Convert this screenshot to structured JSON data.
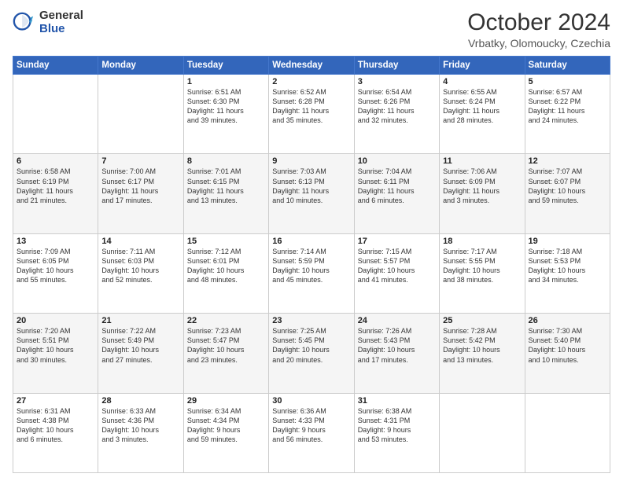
{
  "header": {
    "logo": {
      "general": "General",
      "blue": "Blue"
    },
    "title": "October 2024",
    "location": "Vrbatky, Olomoucky, Czechia"
  },
  "calendar": {
    "days_of_week": [
      "Sunday",
      "Monday",
      "Tuesday",
      "Wednesday",
      "Thursday",
      "Friday",
      "Saturday"
    ],
    "weeks": [
      [
        {
          "day": "",
          "detail": ""
        },
        {
          "day": "",
          "detail": ""
        },
        {
          "day": "1",
          "detail": "Sunrise: 6:51 AM\nSunset: 6:30 PM\nDaylight: 11 hours\nand 39 minutes."
        },
        {
          "day": "2",
          "detail": "Sunrise: 6:52 AM\nSunset: 6:28 PM\nDaylight: 11 hours\nand 35 minutes."
        },
        {
          "day": "3",
          "detail": "Sunrise: 6:54 AM\nSunset: 6:26 PM\nDaylight: 11 hours\nand 32 minutes."
        },
        {
          "day": "4",
          "detail": "Sunrise: 6:55 AM\nSunset: 6:24 PM\nDaylight: 11 hours\nand 28 minutes."
        },
        {
          "day": "5",
          "detail": "Sunrise: 6:57 AM\nSunset: 6:22 PM\nDaylight: 11 hours\nand 24 minutes."
        }
      ],
      [
        {
          "day": "6",
          "detail": "Sunrise: 6:58 AM\nSunset: 6:19 PM\nDaylight: 11 hours\nand 21 minutes."
        },
        {
          "day": "7",
          "detail": "Sunrise: 7:00 AM\nSunset: 6:17 PM\nDaylight: 11 hours\nand 17 minutes."
        },
        {
          "day": "8",
          "detail": "Sunrise: 7:01 AM\nSunset: 6:15 PM\nDaylight: 11 hours\nand 13 minutes."
        },
        {
          "day": "9",
          "detail": "Sunrise: 7:03 AM\nSunset: 6:13 PM\nDaylight: 11 hours\nand 10 minutes."
        },
        {
          "day": "10",
          "detail": "Sunrise: 7:04 AM\nSunset: 6:11 PM\nDaylight: 11 hours\nand 6 minutes."
        },
        {
          "day": "11",
          "detail": "Sunrise: 7:06 AM\nSunset: 6:09 PM\nDaylight: 11 hours\nand 3 minutes."
        },
        {
          "day": "12",
          "detail": "Sunrise: 7:07 AM\nSunset: 6:07 PM\nDaylight: 10 hours\nand 59 minutes."
        }
      ],
      [
        {
          "day": "13",
          "detail": "Sunrise: 7:09 AM\nSunset: 6:05 PM\nDaylight: 10 hours\nand 55 minutes."
        },
        {
          "day": "14",
          "detail": "Sunrise: 7:11 AM\nSunset: 6:03 PM\nDaylight: 10 hours\nand 52 minutes."
        },
        {
          "day": "15",
          "detail": "Sunrise: 7:12 AM\nSunset: 6:01 PM\nDaylight: 10 hours\nand 48 minutes."
        },
        {
          "day": "16",
          "detail": "Sunrise: 7:14 AM\nSunset: 5:59 PM\nDaylight: 10 hours\nand 45 minutes."
        },
        {
          "day": "17",
          "detail": "Sunrise: 7:15 AM\nSunset: 5:57 PM\nDaylight: 10 hours\nand 41 minutes."
        },
        {
          "day": "18",
          "detail": "Sunrise: 7:17 AM\nSunset: 5:55 PM\nDaylight: 10 hours\nand 38 minutes."
        },
        {
          "day": "19",
          "detail": "Sunrise: 7:18 AM\nSunset: 5:53 PM\nDaylight: 10 hours\nand 34 minutes."
        }
      ],
      [
        {
          "day": "20",
          "detail": "Sunrise: 7:20 AM\nSunset: 5:51 PM\nDaylight: 10 hours\nand 30 minutes."
        },
        {
          "day": "21",
          "detail": "Sunrise: 7:22 AM\nSunset: 5:49 PM\nDaylight: 10 hours\nand 27 minutes."
        },
        {
          "day": "22",
          "detail": "Sunrise: 7:23 AM\nSunset: 5:47 PM\nDaylight: 10 hours\nand 23 minutes."
        },
        {
          "day": "23",
          "detail": "Sunrise: 7:25 AM\nSunset: 5:45 PM\nDaylight: 10 hours\nand 20 minutes."
        },
        {
          "day": "24",
          "detail": "Sunrise: 7:26 AM\nSunset: 5:43 PM\nDaylight: 10 hours\nand 17 minutes."
        },
        {
          "day": "25",
          "detail": "Sunrise: 7:28 AM\nSunset: 5:42 PM\nDaylight: 10 hours\nand 13 minutes."
        },
        {
          "day": "26",
          "detail": "Sunrise: 7:30 AM\nSunset: 5:40 PM\nDaylight: 10 hours\nand 10 minutes."
        }
      ],
      [
        {
          "day": "27",
          "detail": "Sunrise: 6:31 AM\nSunset: 4:38 PM\nDaylight: 10 hours\nand 6 minutes."
        },
        {
          "day": "28",
          "detail": "Sunrise: 6:33 AM\nSunset: 4:36 PM\nDaylight: 10 hours\nand 3 minutes."
        },
        {
          "day": "29",
          "detail": "Sunrise: 6:34 AM\nSunset: 4:34 PM\nDaylight: 9 hours\nand 59 minutes."
        },
        {
          "day": "30",
          "detail": "Sunrise: 6:36 AM\nSunset: 4:33 PM\nDaylight: 9 hours\nand 56 minutes."
        },
        {
          "day": "31",
          "detail": "Sunrise: 6:38 AM\nSunset: 4:31 PM\nDaylight: 9 hours\nand 53 minutes."
        },
        {
          "day": "",
          "detail": ""
        },
        {
          "day": "",
          "detail": ""
        }
      ]
    ]
  }
}
